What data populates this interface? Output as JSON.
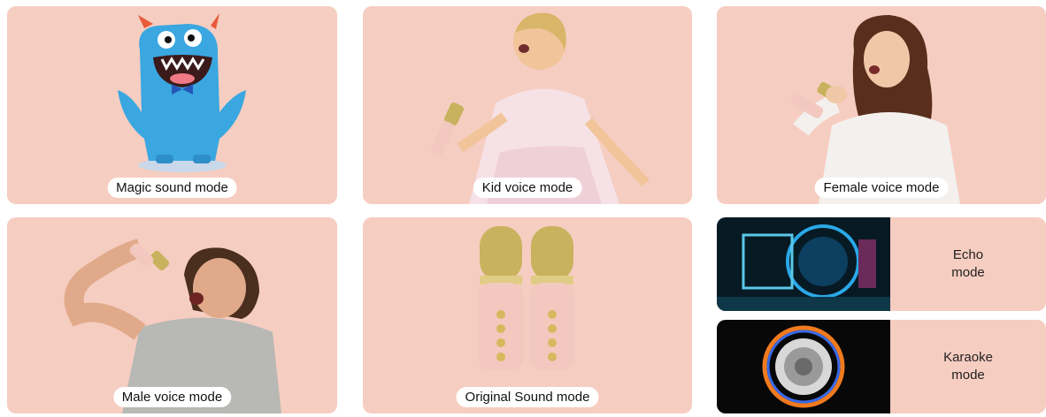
{
  "colors": {
    "card_bg": "#f6cdc1",
    "pill_bg": "#ffffff",
    "mic_pink": "#f3c8bf",
    "mic_gold": "#c8b25e"
  },
  "cards": [
    {
      "label": "Magic sound mode",
      "image": "blue-monster-illustration"
    },
    {
      "label": "Kid voice mode",
      "image": "girl-singing-photo"
    },
    {
      "label": "Female voice mode",
      "image": "woman-singing-photo"
    },
    {
      "label": "Male voice mode",
      "image": "man-singing-photo"
    },
    {
      "label": "Original Sound mode",
      "image": "two-pink-microphones-photo"
    }
  ],
  "split_cards": [
    {
      "line1": "Echo",
      "line2": "mode",
      "image": "neon-tunnel-photo"
    },
    {
      "line1": "Karaoke",
      "line2": "mode",
      "image": "speaker-glow-photo"
    }
  ]
}
